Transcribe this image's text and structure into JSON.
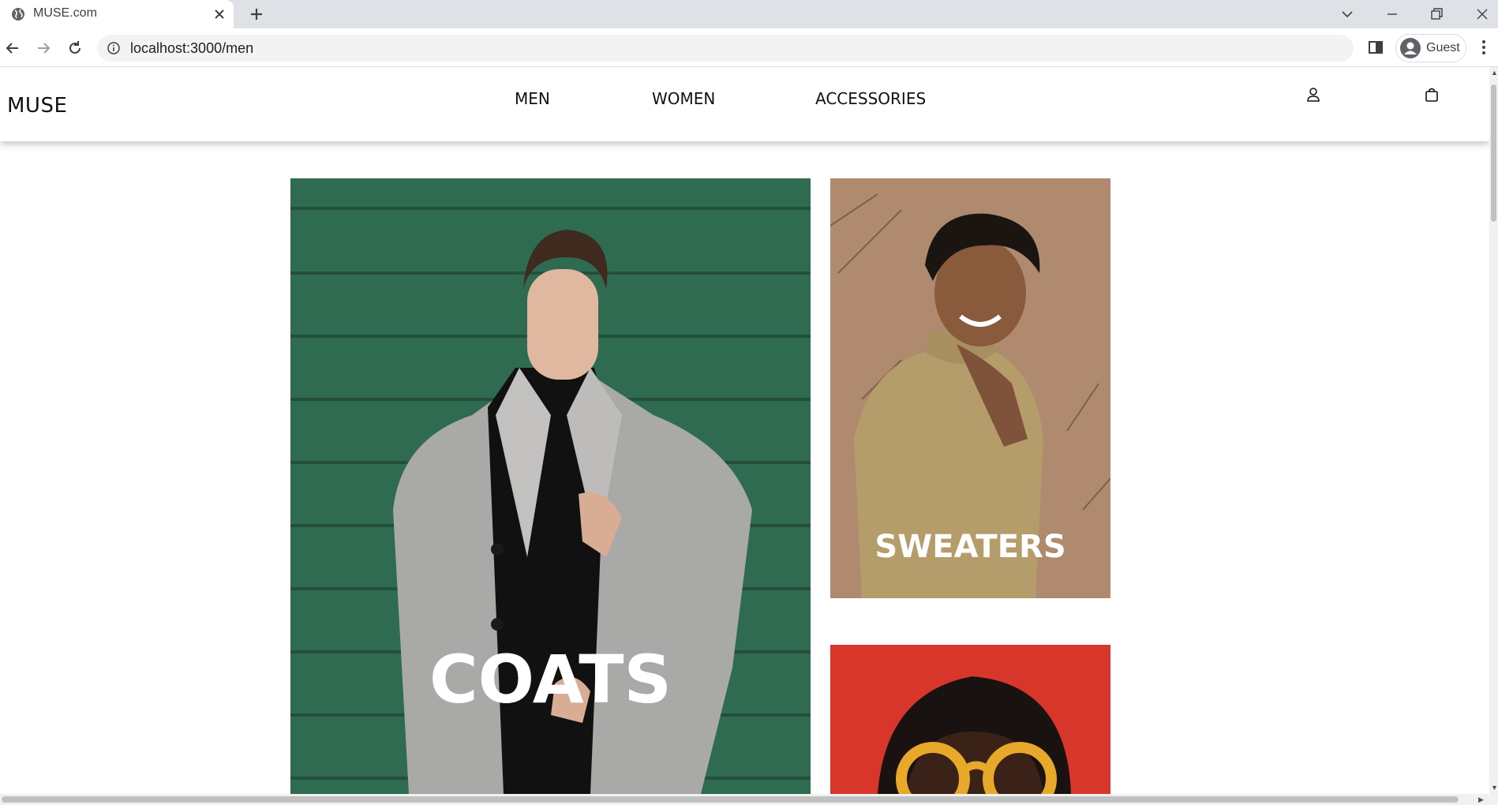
{
  "browser": {
    "tab_title": "MUSE.com",
    "url": "localhost:3000/men",
    "profile_label": "Guest",
    "icons": {
      "favicon": "globe-icon",
      "tab_close": "close-icon",
      "new_tab": "plus-icon",
      "back": "back-arrow-icon",
      "forward": "forward-arrow-icon",
      "reload": "reload-icon",
      "site_info": "info-icon",
      "side_panel": "side-panel-icon",
      "profile": "profile-avatar-icon",
      "menu": "kebab-menu-icon",
      "tab_search": "chevron-down-icon",
      "minimize": "minimize-icon",
      "restore": "restore-icon",
      "close_window": "close-icon"
    }
  },
  "site": {
    "logo": "MUSE",
    "nav": [
      {
        "label": "MEN"
      },
      {
        "label": "WOMEN"
      },
      {
        "label": "ACCESSORIES"
      }
    ],
    "icons": {
      "account": "user-icon",
      "cart": "shopping-bag-icon"
    }
  },
  "categories": [
    {
      "label": "COATS",
      "background": "#2f6b50"
    },
    {
      "label": "SWEATERS",
      "background": "#b08a6e"
    },
    {
      "label": "",
      "background": "#d9362b"
    }
  ]
}
